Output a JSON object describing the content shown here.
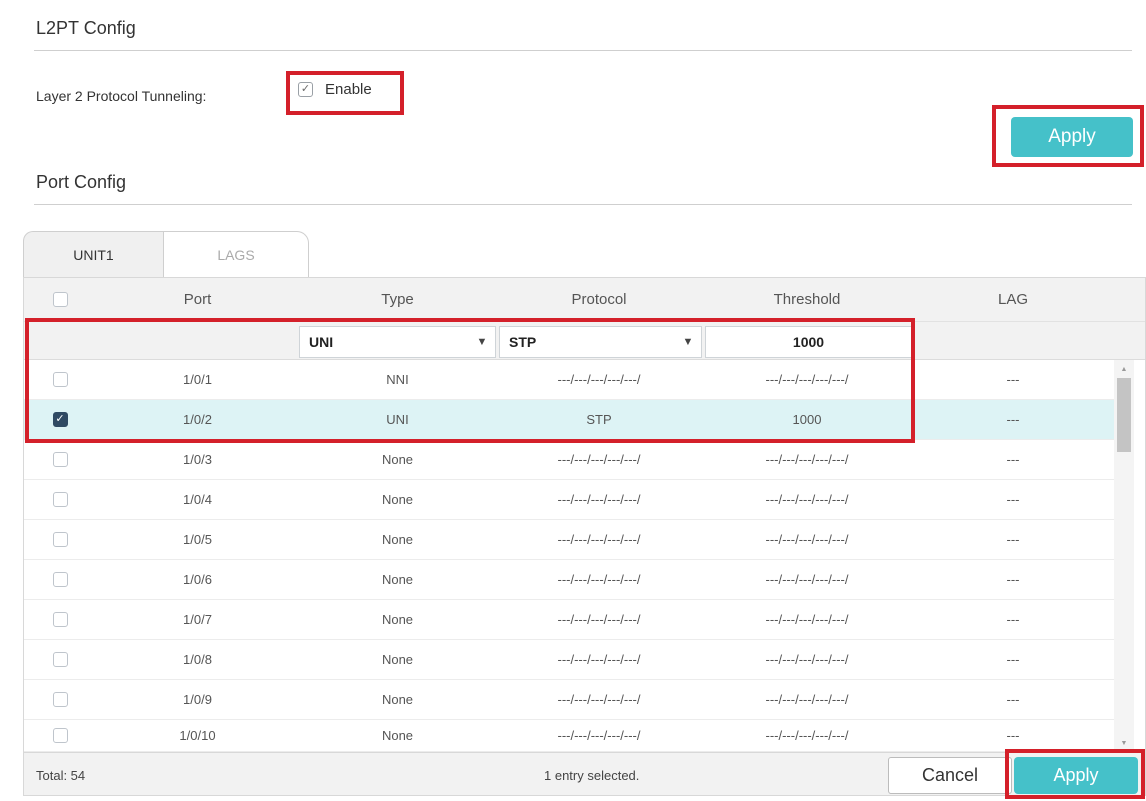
{
  "l2pt_section": {
    "title": "L2PT Config",
    "field_label": "Layer 2 Protocol Tunneling:",
    "enable_label": "Enable",
    "enable_checked": true,
    "apply_label": "Apply"
  },
  "port_section": {
    "title": "Port Config",
    "tabs": [
      {
        "label": "UNIT1",
        "active": true
      },
      {
        "label": "LAGS",
        "active": false
      }
    ],
    "columns": [
      "Port",
      "Type",
      "Protocol",
      "Threshold",
      "LAG"
    ],
    "filter": {
      "type_value": "UNI",
      "protocol_value": "STP",
      "threshold_value": "1000"
    },
    "rows": [
      {
        "port": "1/0/1",
        "type": "NNI",
        "protocol": "---/---/---/---/---/",
        "threshold": "---/---/---/---/---/",
        "lag": "---",
        "checked": false
      },
      {
        "port": "1/0/2",
        "type": "UNI",
        "protocol": "STP",
        "threshold": "1000",
        "lag": "---",
        "checked": true
      },
      {
        "port": "1/0/3",
        "type": "None",
        "protocol": "---/---/---/---/---/",
        "threshold": "---/---/---/---/---/",
        "lag": "---",
        "checked": false
      },
      {
        "port": "1/0/4",
        "type": "None",
        "protocol": "---/---/---/---/---/",
        "threshold": "---/---/---/---/---/",
        "lag": "---",
        "checked": false
      },
      {
        "port": "1/0/5",
        "type": "None",
        "protocol": "---/---/---/---/---/",
        "threshold": "---/---/---/---/---/",
        "lag": "---",
        "checked": false
      },
      {
        "port": "1/0/6",
        "type": "None",
        "protocol": "---/---/---/---/---/",
        "threshold": "---/---/---/---/---/",
        "lag": "---",
        "checked": false
      },
      {
        "port": "1/0/7",
        "type": "None",
        "protocol": "---/---/---/---/---/",
        "threshold": "---/---/---/---/---/",
        "lag": "---",
        "checked": false
      },
      {
        "port": "1/0/8",
        "type": "None",
        "protocol": "---/---/---/---/---/",
        "threshold": "---/---/---/---/---/",
        "lag": "---",
        "checked": false
      },
      {
        "port": "1/0/9",
        "type": "None",
        "protocol": "---/---/---/---/---/",
        "threshold": "---/---/---/---/---/",
        "lag": "---",
        "checked": false
      },
      {
        "port": "1/0/10",
        "type": "None",
        "protocol": "---/---/---/---/---/",
        "threshold": "---/---/---/---/---/",
        "lag": "---",
        "checked": false
      }
    ],
    "footer": {
      "total": "Total: 54",
      "selected": "1 entry selected.",
      "cancel_label": "Cancel",
      "apply_label": "Apply"
    }
  },
  "colors": {
    "accent": "#45c1c9",
    "highlight": "#d4202a",
    "selected_row": "#ddf3f5",
    "checked_box": "#2f4a63"
  },
  "icons": {
    "dropdown": "chevron-down-icon",
    "check": "check-icon"
  }
}
